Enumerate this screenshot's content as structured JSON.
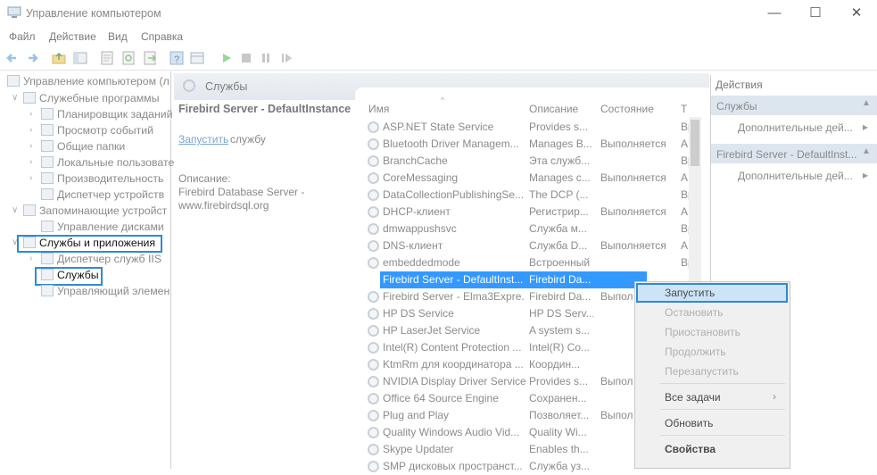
{
  "window": {
    "title": "Управление компьютером",
    "minimize": "—",
    "maximize": "☐",
    "close": "✕"
  },
  "menu": [
    "Файл",
    "Действие",
    "Вид",
    "Справка"
  ],
  "toolbar_icons": [
    "back-icon",
    "forward-icon",
    "folder-up-icon",
    "console-tree-icon",
    "properties-icon",
    "refresh-icon",
    "export-icon",
    "help-icon",
    "details-icon",
    "play-icon",
    "stop-icon",
    "pause-icon",
    "restart-icon"
  ],
  "tree": {
    "root": "Управление компьютером (л",
    "items": [
      "Служебные программы",
      "Планировщик заданий",
      "Просмотр событий",
      "Общие папки",
      "Локальные пользовате",
      "Производительность",
      "Диспетчер устройств",
      "Запоминающие устройст",
      "Управление дисками",
      "Службы и приложения",
      "Диспетчер служб IIS",
      "Службы",
      "Управляющий элемен"
    ]
  },
  "services_panel": {
    "header": "Службы",
    "selected_title": "Firebird Server - DefaultInstance",
    "start_link": "Запустить",
    "start_rest": "службу",
    "desc_label": "Описание:",
    "desc_text": "Firebird Database Server - www.firebirdsql.org"
  },
  "columns": {
    "name": "Имя",
    "desc": "Описание",
    "state": "Состояние",
    "type": "Т"
  },
  "rows": [
    {
      "name": "ASP.NET State Service",
      "desc": "Provides s...",
      "state": "",
      "type": "Вр"
    },
    {
      "name": "Bluetooth Driver Managem...",
      "desc": "Manages B...",
      "state": "Выполняется",
      "type": "А"
    },
    {
      "name": "BranchCache",
      "desc": "Эта служб...",
      "state": "",
      "type": "Вр"
    },
    {
      "name": "CoreMessaging",
      "desc": "Manages c...",
      "state": "Выполняется",
      "type": "А"
    },
    {
      "name": "DataCollectionPublishingSe...",
      "desc": "The DCP (...",
      "state": "",
      "type": "Вр"
    },
    {
      "name": "DHCP-клиент",
      "desc": "Регистрир...",
      "state": "Выполняется",
      "type": "А"
    },
    {
      "name": "dmwappushsvc",
      "desc": "Служба м...",
      "state": "",
      "type": "Вр"
    },
    {
      "name": "DNS-клиент",
      "desc": "Служба D...",
      "state": "Выполняется",
      "type": "А"
    },
    {
      "name": "embeddedmode",
      "desc": "Встроенный режим",
      "state": "",
      "type": "Вр"
    },
    {
      "name": "Firebird Server - DefaultInst...",
      "desc": "Firebird Da...",
      "state": "",
      "type": ""
    },
    {
      "name": "Firebird Server - Elma3Expre...",
      "desc": "Firebird Da...",
      "state": "Выпол",
      "type": ""
    },
    {
      "name": "HP DS Service",
      "desc": "HP DS Serv...",
      "state": "",
      "type": ""
    },
    {
      "name": "HP LaserJet Service",
      "desc": "A system s...",
      "state": "",
      "type": ""
    },
    {
      "name": "Intel(R) Content Protection ...",
      "desc": "Intel(R) Co...",
      "state": "",
      "type": ""
    },
    {
      "name": "KtmRm для координатора ...",
      "desc": "Координ...",
      "state": "",
      "type": ""
    },
    {
      "name": "NVIDIA Display Driver Service",
      "desc": "Provides s...",
      "state": "Выпол",
      "type": ""
    },
    {
      "name": "Office 64 Source Engine",
      "desc": "Сохранен...",
      "state": "",
      "type": ""
    },
    {
      "name": "Plug and Play",
      "desc": "Позволяет...",
      "state": "Выпол",
      "type": ""
    },
    {
      "name": "Quality Windows Audio Vid...",
      "desc": "Quality Wi...",
      "state": "",
      "type": ""
    },
    {
      "name": "Skype Updater",
      "desc": "Enables th...",
      "state": "",
      "type": ""
    },
    {
      "name": "SMP дисковых пространст...",
      "desc": "Служба уз...",
      "state": "",
      "type": ""
    }
  ],
  "actions": {
    "title": "Действия",
    "group1": "Службы",
    "more1": "Дополнительные дей...",
    "group2": "Firebird Server - DefaultInst...",
    "more2": "Дополнительные дей..."
  },
  "context_menu": {
    "start": "Запустить",
    "stop": "Остановить",
    "pause": "Приостановить",
    "resume": "Продолжить",
    "restart": "Перезапустить",
    "all_tasks": "Все задачи",
    "refresh": "Обновить",
    "properties": "Свойства"
  },
  "colors": {
    "selection": "#3399ff",
    "highlight_box": "#2f8ad6",
    "header_gradient": "#e3e8ee"
  }
}
